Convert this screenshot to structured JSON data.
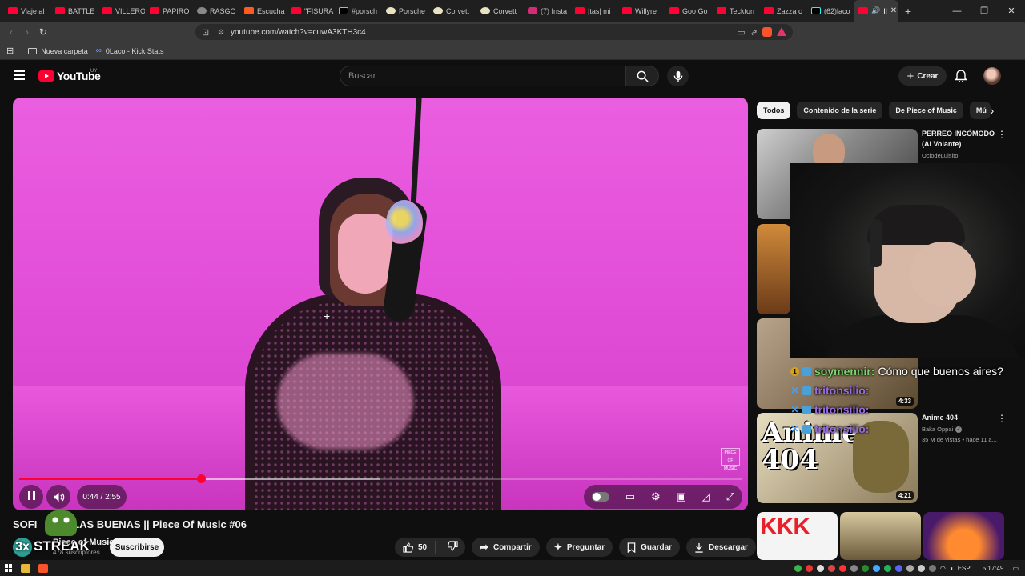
{
  "browser": {
    "tabs": [
      {
        "label": "Viaje al",
        "icon": "youtube-icon"
      },
      {
        "label": "BATTLE",
        "icon": "youtube-icon"
      },
      {
        "label": "VILLERO",
        "icon": "youtube-icon"
      },
      {
        "label": "PAPIRO",
        "icon": "youtube-icon"
      },
      {
        "label": "RASGO",
        "icon": "chrome-icon"
      },
      {
        "label": "Escucha",
        "icon": "music-icon"
      },
      {
        "label": "\"FISURA",
        "icon": "youtube-icon"
      },
      {
        "label": "#porsch",
        "icon": "tiktok-icon"
      },
      {
        "label": "Porsche",
        "icon": "corvette-icon"
      },
      {
        "label": "Corvett",
        "icon": "corvette-icon"
      },
      {
        "label": "Corvett",
        "icon": "corvette-icon"
      },
      {
        "label": "(7) Insta",
        "icon": "instagram-icon"
      },
      {
        "label": "|tas| mi",
        "icon": "youtube-icon"
      },
      {
        "label": "Willyre",
        "icon": "youtube-icon"
      },
      {
        "label": "Goo Go",
        "icon": "youtube-icon"
      },
      {
        "label": "Teckton",
        "icon": "youtube-icon"
      },
      {
        "label": "Zazza c",
        "icon": "youtube-icon"
      },
      {
        "label": "(62)laco",
        "icon": "tiktok-icon"
      }
    ],
    "active_tab_icon": "youtube-icon",
    "url": "youtube.com/watch?v=cuwA3KTH3c4",
    "bookmarks": [
      "Nueva carpeta",
      "0Laco - Kick Stats"
    ]
  },
  "youtube": {
    "logo_text": "YouTube",
    "country_code": "UY",
    "search_placeholder": "Buscar",
    "create_label": "Crear"
  },
  "player": {
    "current_time": "0:44",
    "duration": "2:55",
    "time_display": "0:44 / 2:55",
    "progress_fraction": 0.2514,
    "buffered_fraction": 0.5,
    "watermark": "PIECE OF MUSIC"
  },
  "video": {
    "title": "SOFI ... AGUILAS BUENAS || Piece Of Music #06",
    "title_visible": "SOFI",
    "title_rest": "JILAS BUENAS || Piece Of Music #06",
    "channel": "Piece of Music",
    "subscribers": "478 suscriptores",
    "subscribe_label": "Suscribirse",
    "likes": "50",
    "share_label": "Compartir",
    "ask_label": "Preguntar",
    "save_label": "Guardar",
    "download_label": "Descargar"
  },
  "streak_overlay": {
    "count": "3x",
    "label": "STREAK"
  },
  "chips": [
    "Todos",
    "Contenido de la serie",
    "De Piece of Music",
    "Mú"
  ],
  "recommendations": [
    {
      "title": "PERREO INCÓMODO (Al Volante)",
      "channel": "OciodeLuisito",
      "meta": "",
      "duration": ""
    },
    {
      "title": "",
      "channel": "",
      "meta": "",
      "duration": "4:33"
    },
    {
      "title": "Anime 404",
      "channel": "Baka Oppai",
      "meta": "35 M de vistas • hace 11 a...",
      "duration": "4:21",
      "thumb_text": "Anime 404"
    },
    {
      "title": "",
      "channel": "",
      "meta": "",
      "duration": "",
      "thumb_text": "KKK"
    }
  ],
  "chat": [
    {
      "user": "soymennir:",
      "text": "Cómo que buenos aires?"
    },
    {
      "user": "tritonsilio:",
      "text": ""
    },
    {
      "user": "tritonsilio:",
      "text": ""
    },
    {
      "user": "tritonsilio:",
      "text": ""
    }
  ],
  "taskbar": {
    "language": "ESP",
    "time": "5:17:49"
  },
  "colors": {
    "youtube_red": "#ff0033",
    "background": "#0f0f0f",
    "chip_bg": "#272727",
    "video_pink": "#e34fd9"
  }
}
